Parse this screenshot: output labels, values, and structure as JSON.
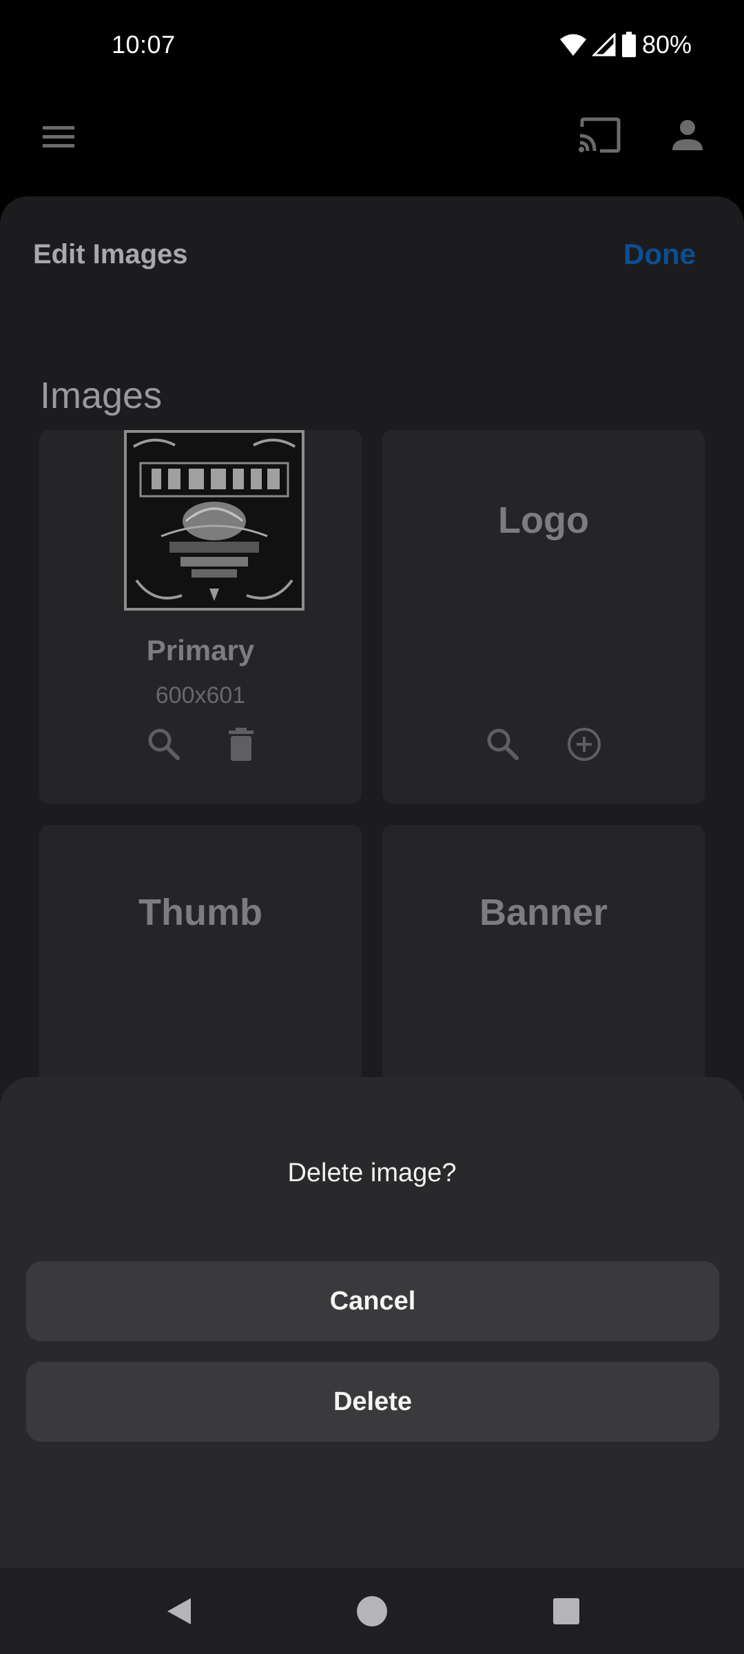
{
  "status_bar": {
    "time": "10:07",
    "battery": "80%"
  },
  "page": {
    "title": "Edit Images",
    "done_label": "Done",
    "section_title": "Images"
  },
  "cards": [
    {
      "label": "Primary",
      "size": "600x601"
    },
    {
      "label": "Logo"
    },
    {
      "label": "Thumb"
    },
    {
      "label": "Banner"
    }
  ],
  "dialog": {
    "title": "Delete image?",
    "cancel_label": "Cancel",
    "delete_label": "Delete"
  },
  "icons": {
    "menu": "menu-icon",
    "cast": "cast-icon",
    "account": "account-icon",
    "search": "search-icon",
    "delete": "trash-icon",
    "add": "add-circle-icon",
    "back": "back-icon",
    "home": "home-icon",
    "recents": "recents-icon"
  },
  "colors": {
    "accent": "#0b4f94",
    "dialog_bg": "#29292b",
    "card_bg": "#252527"
  }
}
